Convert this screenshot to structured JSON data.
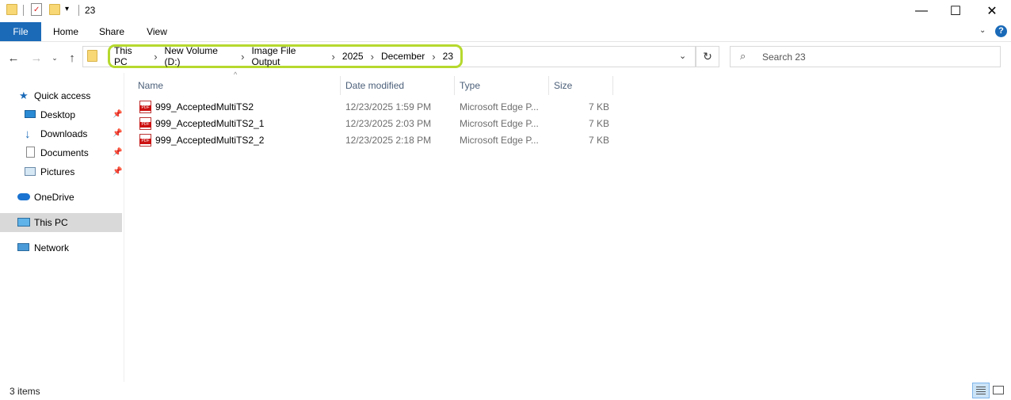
{
  "window": {
    "title": "23",
    "controls": {
      "minimize": "—",
      "maximize": "☐",
      "close": "✕"
    }
  },
  "ribbon": {
    "tabs": [
      "File",
      "Home",
      "Share",
      "View"
    ],
    "help": "?"
  },
  "address": {
    "breadcrumbs": [
      "This PC",
      "New Volume (D:)",
      "Image File Output",
      "2025",
      "December",
      "23"
    ],
    "separator": "›"
  },
  "search": {
    "placeholder": "Search 23"
  },
  "sidebar": {
    "items": [
      {
        "label": "Quick access",
        "icon": "star-icon"
      },
      {
        "label": "Desktop",
        "icon": "desktop-icon",
        "pinned": true
      },
      {
        "label": "Downloads",
        "icon": "download-icon",
        "pinned": true
      },
      {
        "label": "Documents",
        "icon": "documents-icon",
        "pinned": true
      },
      {
        "label": "Pictures",
        "icon": "pictures-icon",
        "pinned": true
      },
      {
        "label": "OneDrive",
        "icon": "cloud-icon"
      },
      {
        "label": "This PC",
        "icon": "computer-icon",
        "selected": true
      },
      {
        "label": "Network",
        "icon": "network-icon"
      }
    ]
  },
  "columns": {
    "name": "Name",
    "date": "Date modified",
    "type": "Type",
    "size": "Size"
  },
  "files": [
    {
      "name": "999_AcceptedMultiTS2",
      "date": "12/23/2025 1:59 PM",
      "type": "Microsoft Edge P...",
      "size": "7 KB"
    },
    {
      "name": "999_AcceptedMultiTS2_1",
      "date": "12/23/2025 2:03 PM",
      "type": "Microsoft Edge P...",
      "size": "7 KB"
    },
    {
      "name": "999_AcceptedMultiTS2_2",
      "date": "12/23/2025 2:18 PM",
      "type": "Microsoft Edge P...",
      "size": "7 KB"
    }
  ],
  "status": {
    "count": "3 items"
  },
  "colors": {
    "accent": "#1a6ab8",
    "highlight": "#b6d92e",
    "selected": "#d9d9d9"
  }
}
